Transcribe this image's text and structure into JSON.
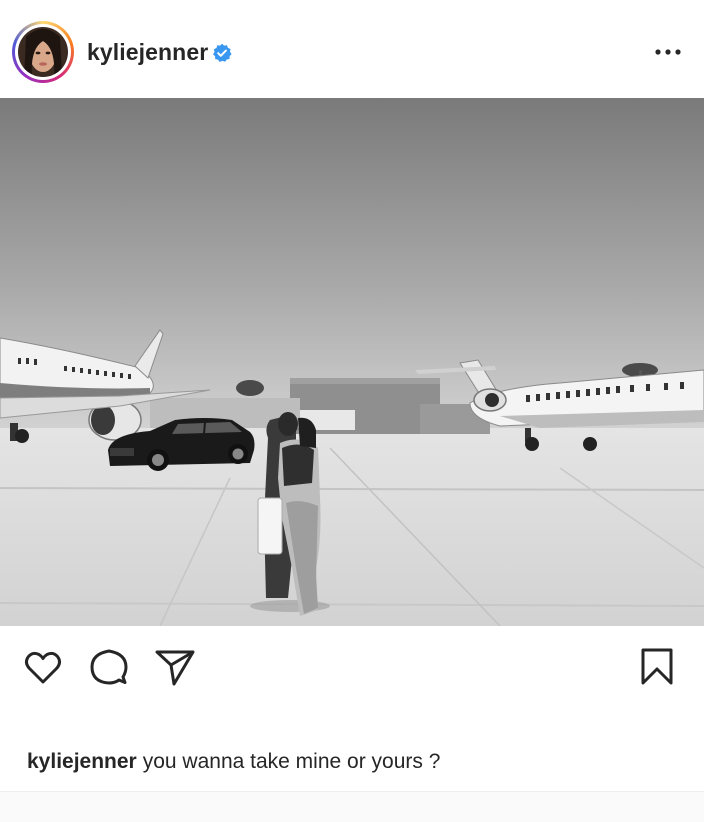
{
  "post": {
    "username": "kyliejenner",
    "verified": true,
    "caption_username": "kyliejenner",
    "caption_text": "you wanna take mine or yours ?"
  },
  "icons": {
    "avatar": "profile-avatar",
    "verified": "verified-badge-icon",
    "more": "more-options-icon",
    "like": "heart-icon",
    "comment": "comment-bubble-icon",
    "share": "paper-plane-icon",
    "save": "bookmark-icon"
  },
  "colors": {
    "verified_blue": "#3897f0",
    "text": "#262626"
  }
}
